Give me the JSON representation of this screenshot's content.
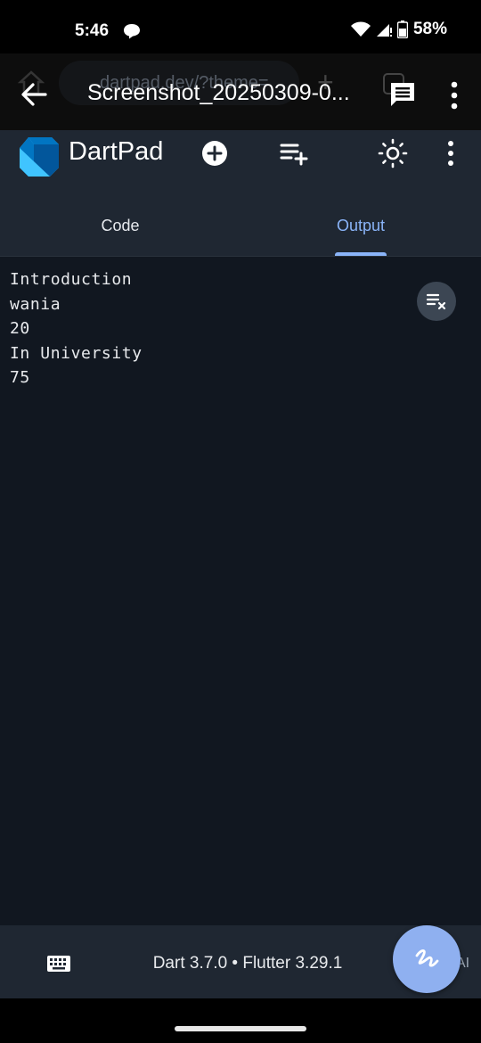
{
  "status_bar": {
    "time": "5:46",
    "battery": "58%"
  },
  "browser": {
    "ghost_url": "dartpad.dev/?theme=",
    "document_title": "Screenshot_20250309-0..."
  },
  "app": {
    "title": "DartPad",
    "tabs": [
      {
        "label": "Code",
        "active": false
      },
      {
        "label": "Output",
        "active": true
      }
    ]
  },
  "console": {
    "lines": [
      "Introduction",
      "wania",
      "20",
      "In University",
      "75"
    ]
  },
  "footer": {
    "version": "Dart 3.7.0 • Flutter 3.29.1",
    "ai_fragment": "AI"
  },
  "colors": {
    "accent": "#8ab4f8",
    "header_bg": "#1f2732",
    "output_bg": "#111720",
    "fab": "#8fb0f0"
  }
}
